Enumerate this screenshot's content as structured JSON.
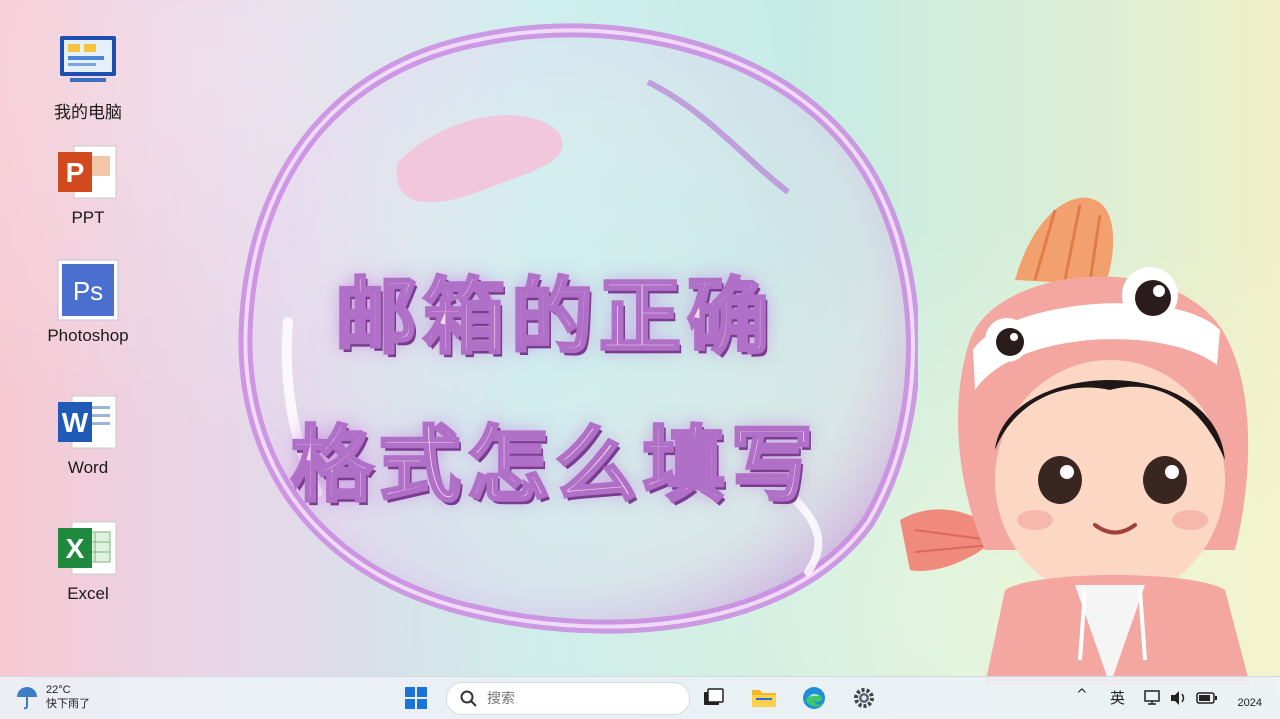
{
  "desktop": {
    "icons": [
      {
        "label": "我的电脑",
        "icon": "computer-icon"
      },
      {
        "label": "PPT",
        "icon": "powerpoint-icon"
      },
      {
        "label": "Photoshop",
        "icon": "photoshop-icon"
      },
      {
        "label": "Word",
        "icon": "word-icon"
      },
      {
        "label": "Excel",
        "icon": "excel-icon"
      }
    ]
  },
  "wallpaper": {
    "title_line1": "邮箱的正确",
    "title_line2": "格式怎么填写",
    "ps_glyph": "Ps",
    "word_glyph": "W",
    "excel_glyph": "X",
    "ppt_glyph": "P"
  },
  "taskbar": {
    "weather_temp": "22°C",
    "weather_desc": "快下雨了",
    "search_placeholder": "搜索",
    "tray_ime": "英",
    "tray_chevron": "^",
    "clock_year": "2024"
  },
  "colors": {
    "title_fill": "#f7d9ee",
    "title_stroke": "#b070c8",
    "bubble": "#c98be0",
    "taskbar": "#ecf1f6"
  }
}
